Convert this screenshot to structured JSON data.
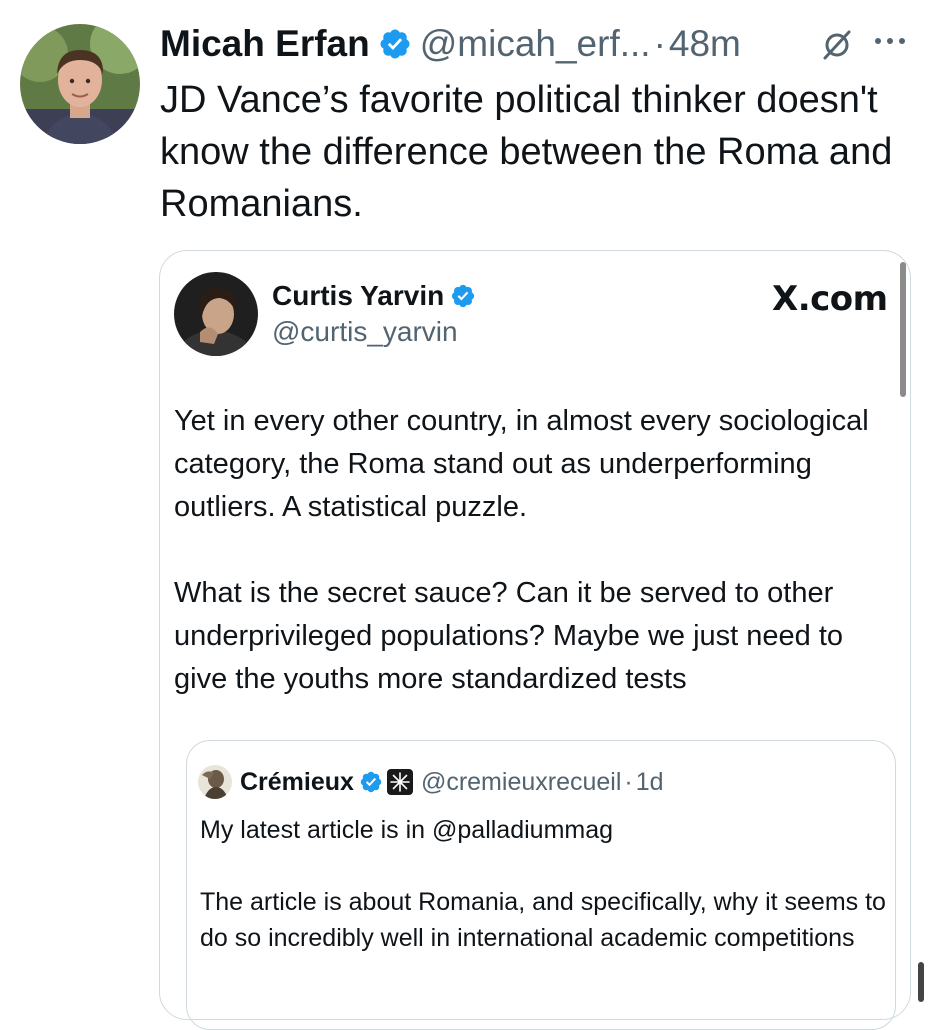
{
  "tweet": {
    "author_name": "Micah Erfan",
    "handle": "@micah_erf...",
    "separator": "·",
    "time": "48m",
    "text": "JD Vance’s favorite political thinker doesn't know the difference between the Roma and Romanians."
  },
  "quote": {
    "author_name": "Curtis Yarvin",
    "handle": "@curtis_yarvin",
    "source_label": "X.com",
    "paragraphs": [
      "Yet in every other country, in almost every sociological category, the Roma stand out as underperforming outliers. A statistical puzzle.",
      "What is the secret sauce? Can it be served to other underprivileged populations? Maybe we just need to give the youths more standardized tests"
    ]
  },
  "nested_quote": {
    "author_name": "Crémieux",
    "handle": "@cremieuxrecueil",
    "separator": "·",
    "time": "1d",
    "paragraphs": [
      "My latest article is in @palladiummag",
      "The article is about Romania, and specifically, why it seems to do so incredibly well in international academic competitions"
    ]
  },
  "colors": {
    "verified_blue": "#1d9bf0",
    "text_primary": "#0f1419",
    "text_secondary": "#536471",
    "border": "#cfd9de"
  },
  "icons": [
    "verified-badge-icon",
    "grok-icon",
    "more-icon",
    "affiliate-badge-icon"
  ]
}
